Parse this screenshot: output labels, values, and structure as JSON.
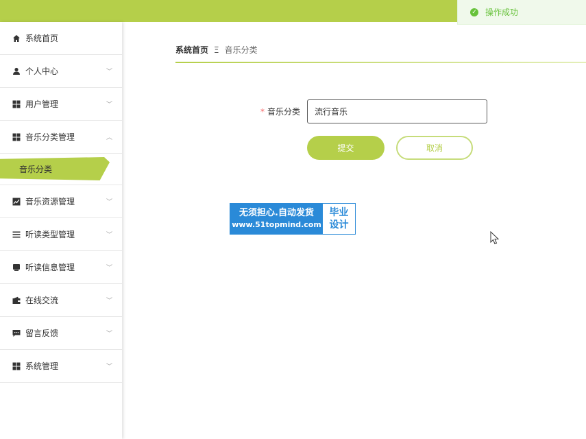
{
  "toast": {
    "text": "操作成功"
  },
  "sidebar": {
    "items": [
      {
        "label": "系统首页",
        "icon": "home-icon",
        "expandable": false
      },
      {
        "label": "个人中心",
        "icon": "user-icon",
        "expandable": true
      },
      {
        "label": "用户管理",
        "icon": "grid-icon",
        "expandable": true
      },
      {
        "label": "音乐分类管理",
        "icon": "grid-icon",
        "expandable": true,
        "expanded": true
      },
      {
        "label": "音乐资源管理",
        "icon": "trend-chart-icon",
        "expandable": true
      },
      {
        "label": "听读类型管理",
        "icon": "list-icon",
        "expandable": true
      },
      {
        "label": "听读信息管理",
        "icon": "monitor-icon",
        "expandable": true
      },
      {
        "label": "在线交流",
        "icon": "wallet-icon",
        "expandable": true
      },
      {
        "label": "留言反馈",
        "icon": "message-icon",
        "expandable": true
      },
      {
        "label": "系统管理",
        "icon": "grid-icon",
        "expandable": true
      }
    ],
    "sub_item": {
      "label": "音乐分类"
    }
  },
  "breadcrumb": {
    "home": "系统首页",
    "separator": "Ξ",
    "current": "音乐分类"
  },
  "form": {
    "label": "音乐分类",
    "required_mark": "*",
    "value": "流行音乐",
    "submit_label": "提交",
    "cancel_label": "取消"
  },
  "watermark": {
    "line1": "无须担心.自动发货",
    "url": "www.51topmind.com",
    "right1": "毕业",
    "right2": "设计"
  },
  "colors": {
    "accent": "#b5cf4a",
    "success": "#67c23a",
    "watermark": "#2a8ad8"
  }
}
